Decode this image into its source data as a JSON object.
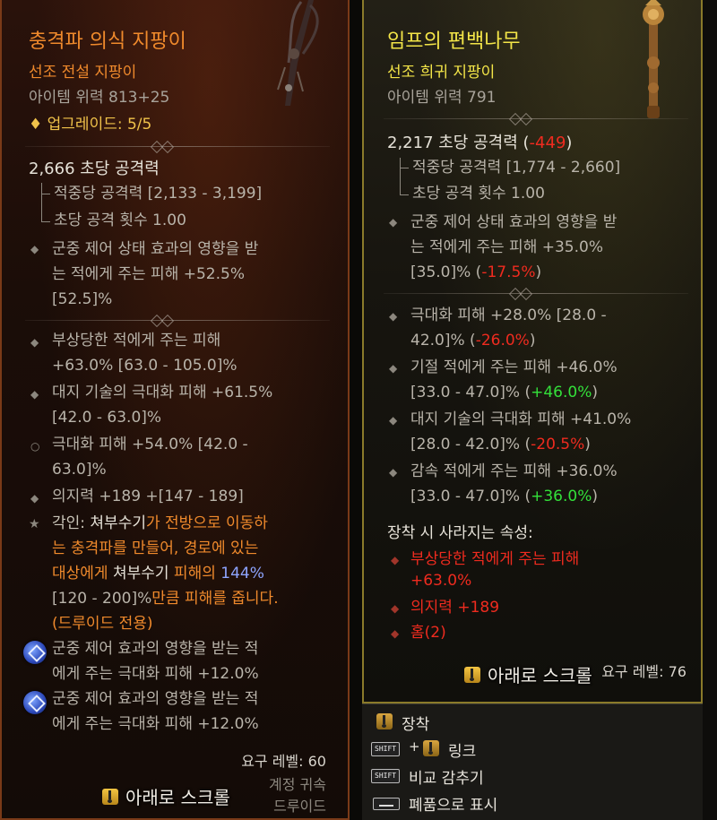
{
  "left": {
    "title": "충격파 의식 지팡이",
    "rarity": "선조 전설 지팡이",
    "item_power": "아이템 위력 813+25",
    "upgrade": "업그레이드: 5/5",
    "dps": "2,666 초당 공격력",
    "damage_per_hit": "적중당 공격력 [2,133 - 3,199]",
    "attacks_per_second": "초당 공격 횟수 1.00",
    "implicit_1": "군중 제어 상태 효과의 영향을 받",
    "implicit_2": "는 적에게 주는 피해 +52.5%",
    "implicit_3": "[52.5]%",
    "affixes": [
      {
        "l1": "부상당한 적에게 주는 피해",
        "l2": "+63.0% [63.0 - 105.0]%"
      },
      {
        "l1": "대지 기술의 극대화 피해 +61.5%",
        "l2": "[42.0 - 63.0]%"
      },
      {
        "l1": "극대화 피해 +54.0% [42.0 -",
        "l2": "63.0]%"
      },
      {
        "l1": "의지력 +189 +[147 - 189]",
        "l2": ""
      }
    ],
    "aspect": {
      "prefix": "각인: ",
      "skill": "쳐부수기",
      "t1": "가 전방으로 이동하",
      "line2": "는 충격파를 만들어, 경로에 있는",
      "line3_a": "대상에게 ",
      "line3_b": "쳐부수기",
      "line3_c": " 피해의 ",
      "line3_value": "144%",
      "line4_range": "[120 - 200]%",
      "line4_rest": "만큼 피해를 줍니다.",
      "line5": "(드루이드 전용)"
    },
    "sockets": [
      {
        "l1": "군중 제어 효과의 영향을 받는 적",
        "l2": "에게 주는 극대화 피해 +12.0%"
      },
      {
        "l1": "군중 제어 효과의 영향을 받는 적",
        "l2": "에게 주는 극대화 피해 +12.0%"
      }
    ],
    "required_level": "요구 레벨: 60",
    "account_bound": "계정 귀속",
    "class_restriction": "드루이드",
    "scroll_hint": "아래로 스크롤"
  },
  "right": {
    "title": "임프의 편백나무",
    "rarity": "선조 희귀 지팡이",
    "item_power": "아이템 위력 791",
    "dps": "2,217 초당 공격력",
    "dps_diff": "-449",
    "dps_paren_open": "(",
    "dps_paren_close": ")",
    "damage_per_hit": "적중당 공격력 [1,774 - 2,660]",
    "attacks_per_second": "초당 공격 횟수 1.00",
    "implicit_1": "군중 제어 상태 효과의 영향을 받",
    "implicit_2": "는 적에게 주는 피해 +35.0%",
    "implicit_3": "[35.0]%",
    "implicit_diff": "-17.5%",
    "affixes": [
      {
        "l1": "극대화 피해 +28.0% [28.0 -",
        "l2": "42.0]%",
        "diff": "-26.0%",
        "diff_color": "red"
      },
      {
        "l1": "기절 적에게 주는 피해 +46.0%",
        "l2": "[33.0 - 47.0]%",
        "diff": "+46.0%",
        "diff_color": "green"
      },
      {
        "l1": "대지 기술의 극대화 피해 +41.0%",
        "l2": "[28.0 - 42.0]%",
        "diff": "-20.5%",
        "diff_color": "red"
      },
      {
        "l1": "감속 적에게 주는 피해 +36.0%",
        "l2": "[33.0 - 47.0]%",
        "diff": "+36.0%",
        "diff_color": "green"
      }
    ],
    "lost_header": "장착 시 사라지는 속성:",
    "lost": [
      "부상당한 적에게 주는 피해",
      "+63.0%",
      "의지력 +189",
      "홈(2)"
    ],
    "required_level": "요구 레벨: 76",
    "scroll_hint": "아래로 스크롤"
  },
  "menu": {
    "equip": "장착",
    "shift_label": "SHIFT",
    "plus": "+",
    "link": "링크",
    "hide_compare": "비교 감추기",
    "mark_junk": "폐품으로 표시"
  },
  "colors": {
    "legendary": "#f08a2c",
    "rare": "#f3e548",
    "negative": "#ef2b1f",
    "positive": "#33e03a",
    "value_highlight": "#8ea5ff"
  }
}
